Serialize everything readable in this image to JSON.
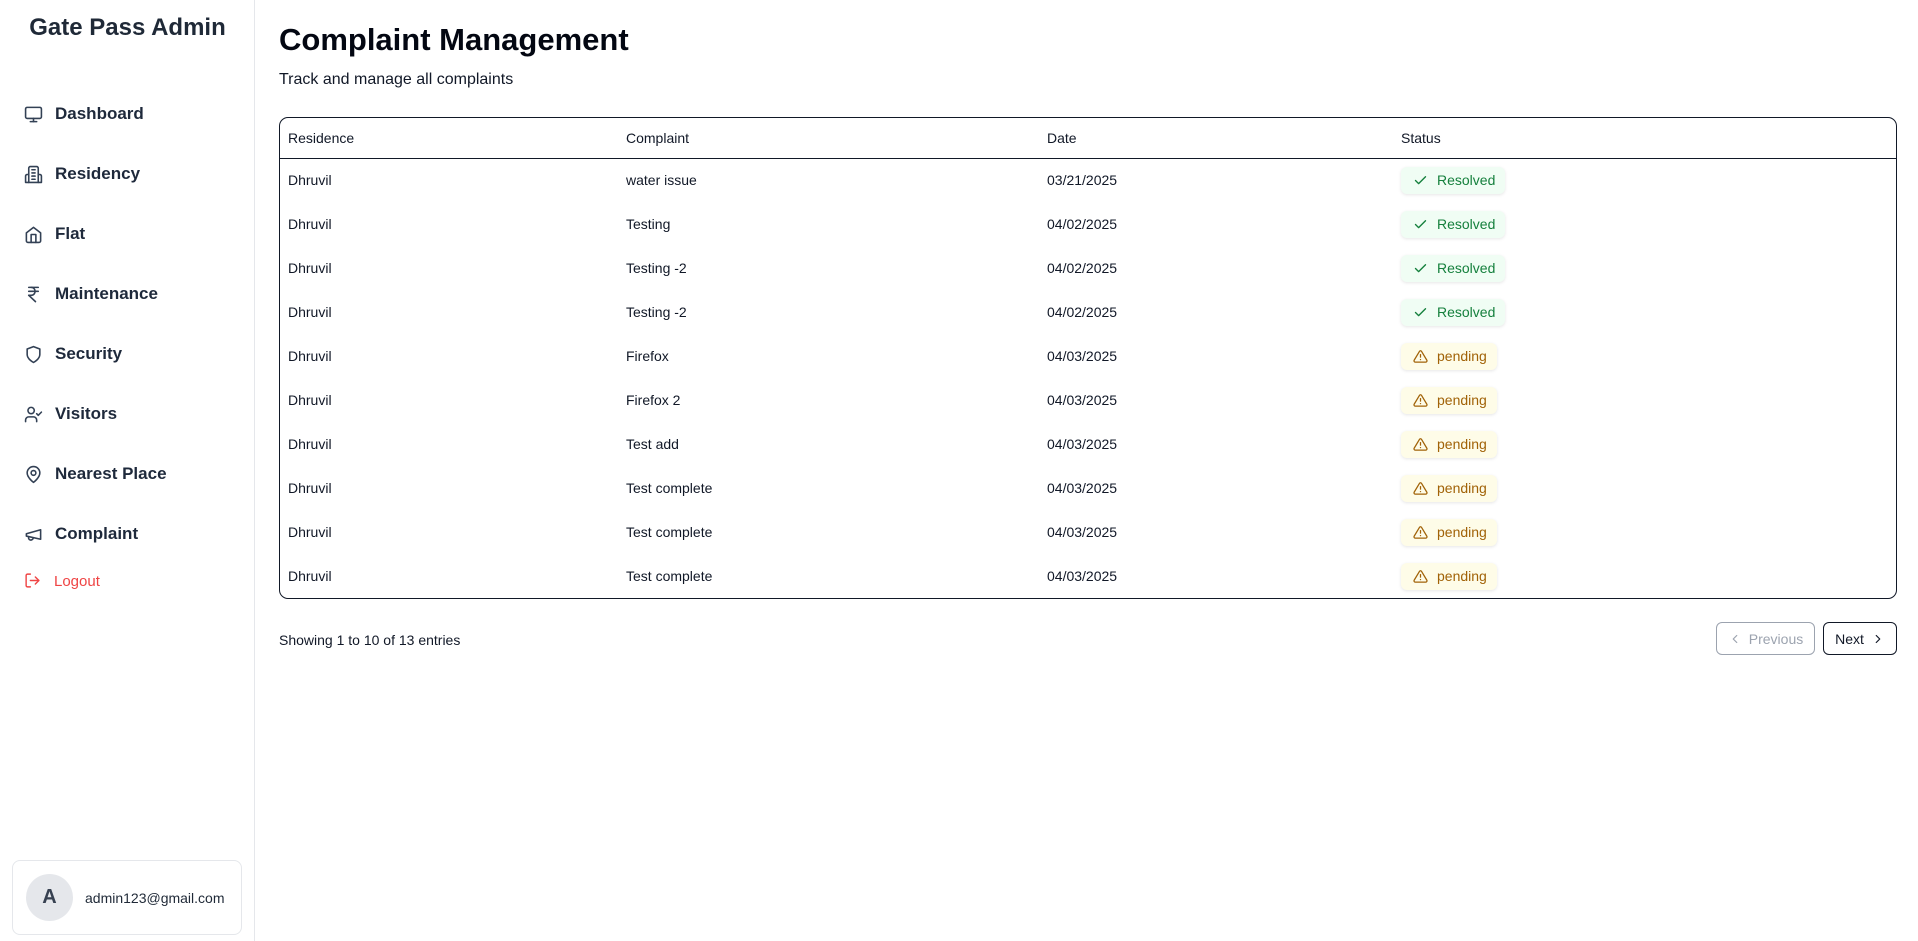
{
  "sidebar": {
    "brand": "Gate Pass Admin",
    "items": [
      {
        "label": "Dashboard",
        "icon": "monitor-icon"
      },
      {
        "label": "Residency",
        "icon": "building-icon"
      },
      {
        "label": "Flat",
        "icon": "home-icon"
      },
      {
        "label": "Maintenance",
        "icon": "rupee-icon"
      },
      {
        "label": "Security",
        "icon": "shield-icon"
      },
      {
        "label": "Visitors",
        "icon": "user-check-icon"
      },
      {
        "label": "Nearest Place",
        "icon": "map-pin-icon"
      },
      {
        "label": "Complaint",
        "icon": "megaphone-icon"
      }
    ],
    "logout_label": "Logout",
    "user": {
      "initial": "A",
      "email": "admin123@gmail.com"
    }
  },
  "header": {
    "title": "Complaint Management",
    "subtitle": "Track and manage all complaints"
  },
  "table": {
    "columns": [
      "Residence",
      "Complaint",
      "Date",
      "Status"
    ],
    "rows": [
      {
        "residence": "Dhruvil",
        "complaint": "water issue",
        "date": "03/21/2025",
        "status": "Resolved"
      },
      {
        "residence": "Dhruvil",
        "complaint": "Testing",
        "date": "04/02/2025",
        "status": "Resolved"
      },
      {
        "residence": "Dhruvil",
        "complaint": "Testing -2",
        "date": "04/02/2025",
        "status": "Resolved"
      },
      {
        "residence": "Dhruvil",
        "complaint": "Testing -2",
        "date": "04/02/2025",
        "status": "Resolved"
      },
      {
        "residence": "Dhruvil",
        "complaint": "Firefox",
        "date": "04/03/2025",
        "status": "pending"
      },
      {
        "residence": "Dhruvil",
        "complaint": "Firefox 2",
        "date": "04/03/2025",
        "status": "pending"
      },
      {
        "residence": "Dhruvil",
        "complaint": "Test add",
        "date": "04/03/2025",
        "status": "pending"
      },
      {
        "residence": "Dhruvil",
        "complaint": "Test complete",
        "date": "04/03/2025",
        "status": "pending"
      },
      {
        "residence": "Dhruvil",
        "complaint": "Test complete",
        "date": "04/03/2025",
        "status": "pending"
      },
      {
        "residence": "Dhruvil",
        "complaint": "Test complete",
        "date": "04/03/2025",
        "status": "pending"
      }
    ]
  },
  "pagination": {
    "summary": "Showing 1 to 10 of 13 entries",
    "previous_label": "Previous",
    "next_label": "Next"
  },
  "colors": {
    "resolved": "#15803d",
    "pending": "#a16207",
    "logout": "#ef4444"
  }
}
